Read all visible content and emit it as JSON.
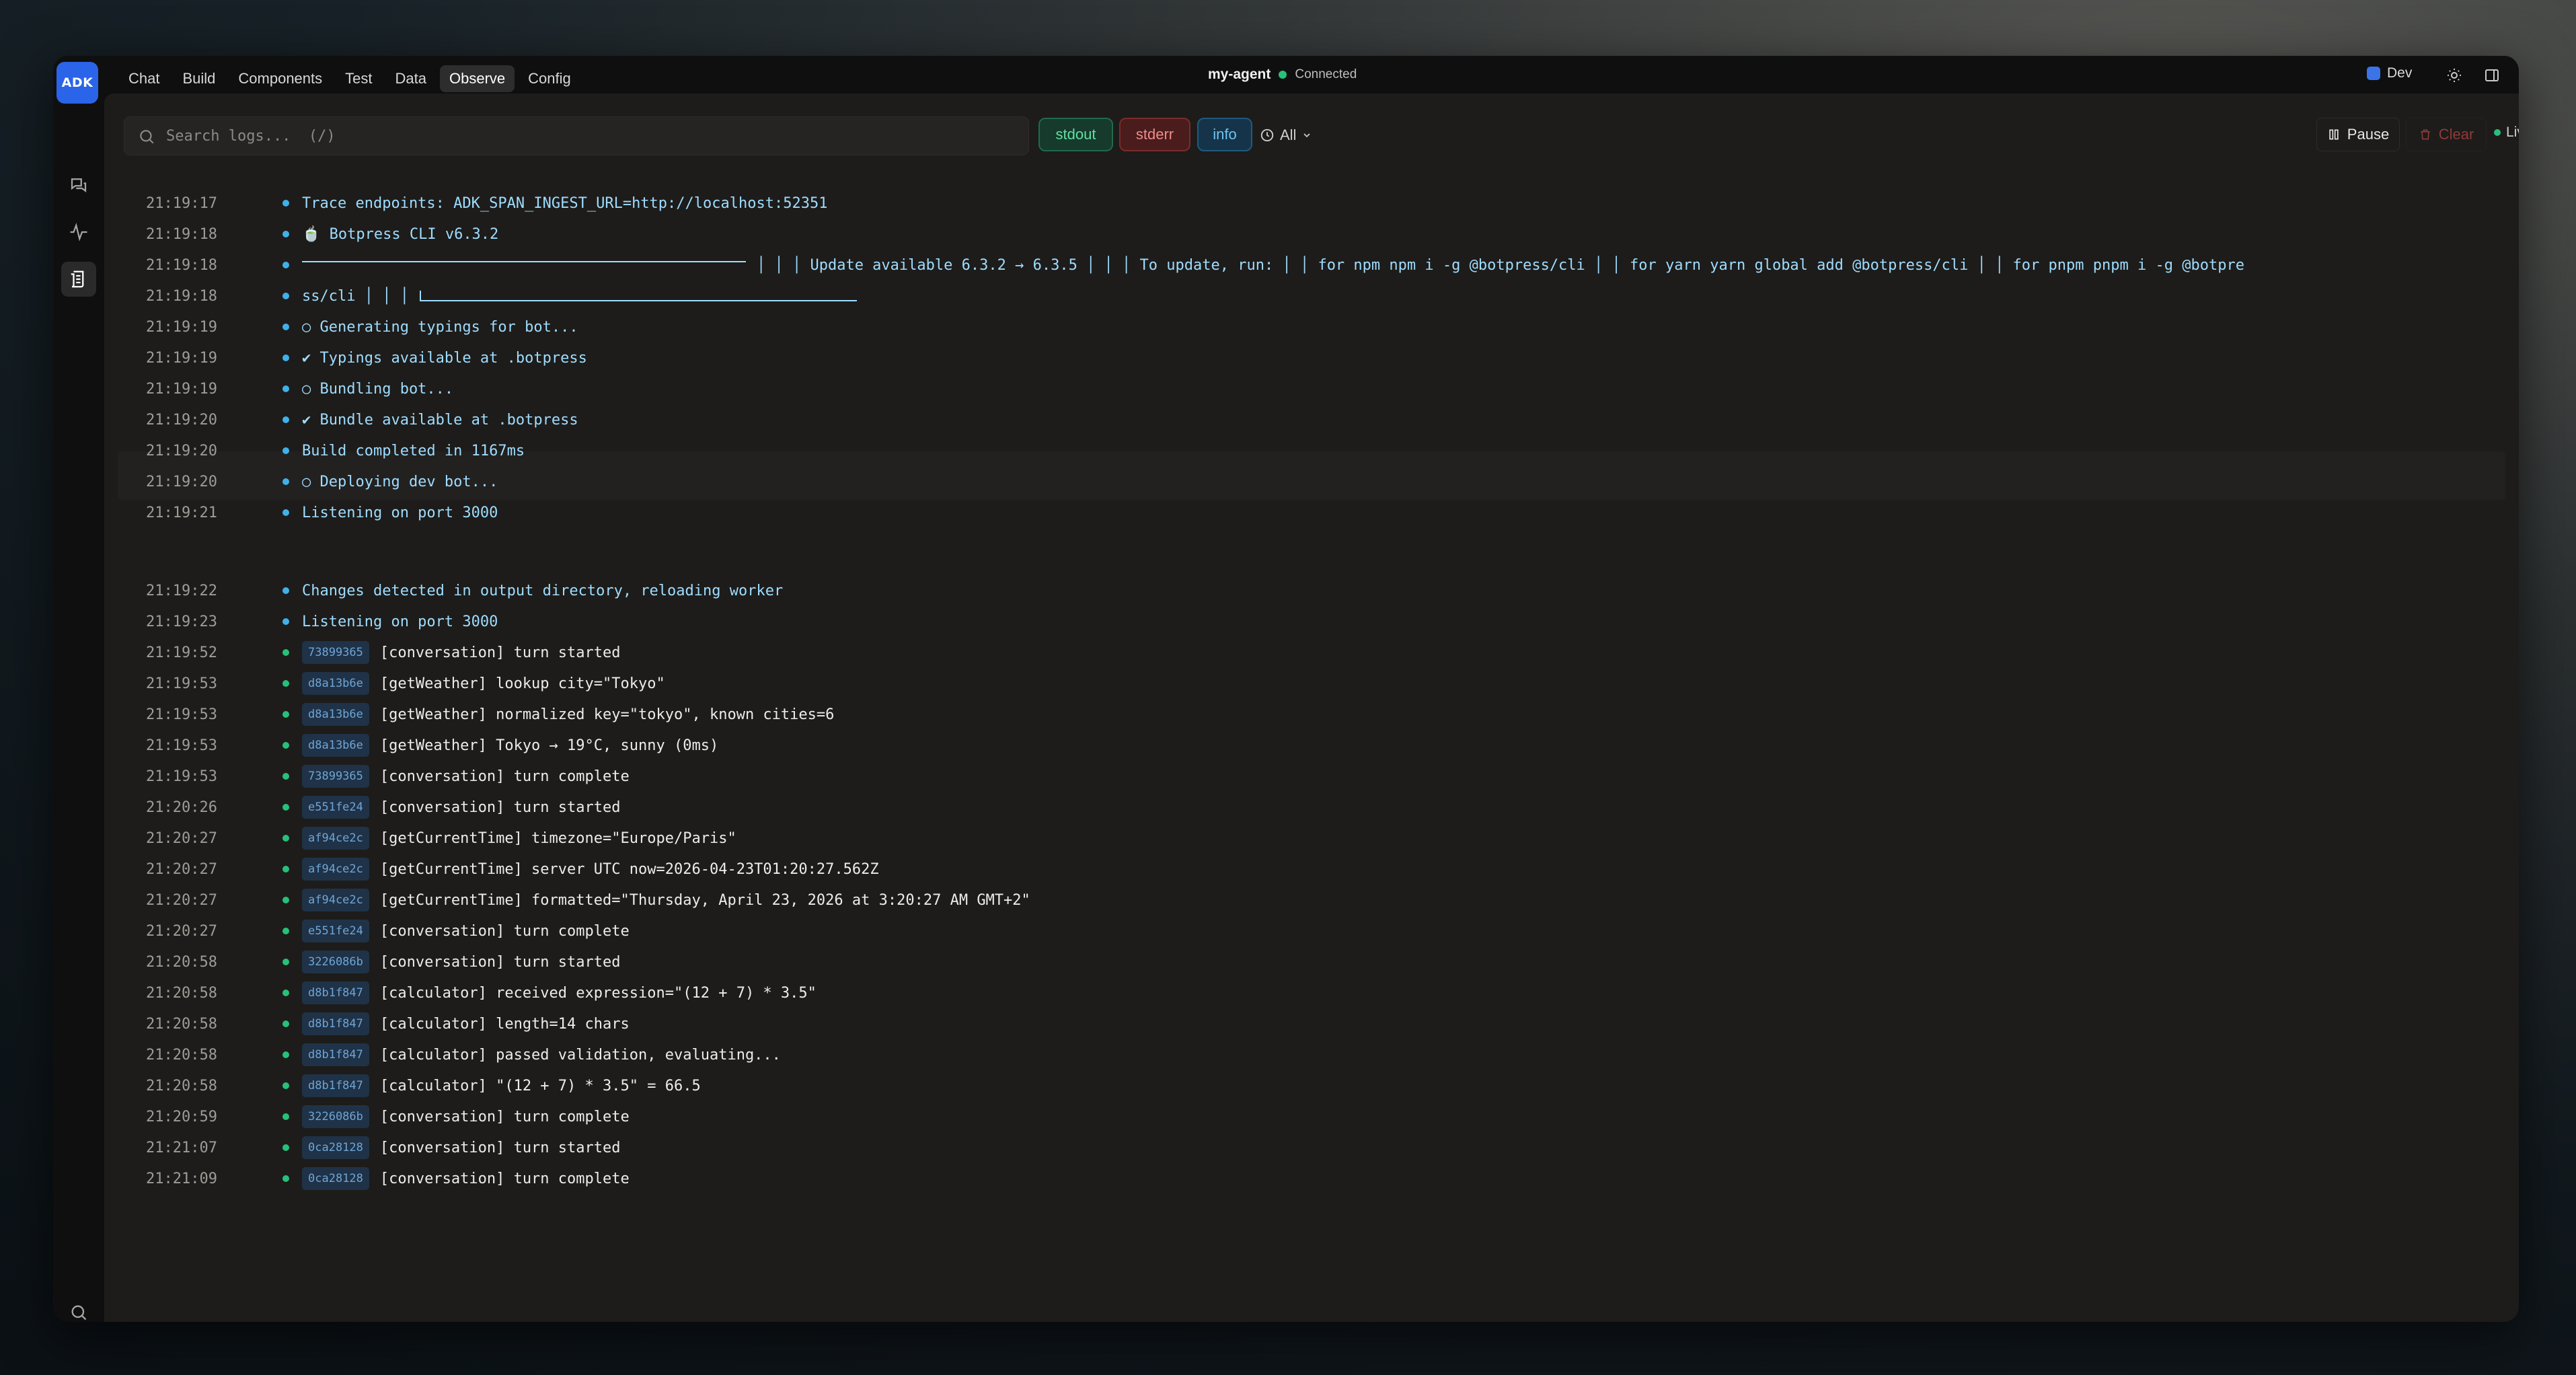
{
  "app": {
    "logo_text": "ADK",
    "agent_name": "my-agent",
    "connection_status": "Connected",
    "environment": "Dev"
  },
  "nav": {
    "items": [
      {
        "label": "Chat"
      },
      {
        "label": "Build"
      },
      {
        "label": "Components"
      },
      {
        "label": "Test"
      },
      {
        "label": "Data"
      },
      {
        "label": "Observe",
        "active": true
      },
      {
        "label": "Config"
      }
    ]
  },
  "toolbar": {
    "search_placeholder": "Search logs...  (/)",
    "filters": {
      "stdout": "stdout",
      "stderr": "stderr",
      "info": "info"
    },
    "level": "All",
    "pause_label": "Pause",
    "clear_label": "Clear",
    "live_label": "Live"
  },
  "logs": [
    {
      "time": "21:19:17",
      "kind": "info",
      "msg": "Trace endpoints: ADK_SPAN_INGEST_URL=http://localhost:52351"
    },
    {
      "time": "21:19:18",
      "kind": "info",
      "msg": "🍵 Botpress CLI v6.3.2"
    },
    {
      "time": "21:19:18",
      "kind": "info",
      "msg": "│ │ │ Update available 6.3.2 → 6.3.5 │ │ │ To update, run: │ │ for npm npm i -g @botpress/cli │ │ for yarn yarn global add @botpress/cli │ │ for pnpm pnpm i -g @botpre",
      "box": "top"
    },
    {
      "time": "21:19:18",
      "kind": "info",
      "msg": "ss/cli │ │ │",
      "box": "bottom"
    },
    {
      "time": "21:19:19",
      "kind": "info",
      "msg": "○ Generating typings for bot..."
    },
    {
      "time": "21:19:19",
      "kind": "info",
      "msg": "✔ Typings available at .botpress"
    },
    {
      "time": "21:19:19",
      "kind": "info",
      "msg": "○ Bundling bot..."
    },
    {
      "time": "21:19:20",
      "kind": "info",
      "msg": "✔ Bundle available at .botpress"
    },
    {
      "time": "21:19:20",
      "kind": "info",
      "msg": "Build completed in 1167ms"
    },
    {
      "time": "21:19:20",
      "kind": "info",
      "msg": "○ Deploying dev bot..."
    },
    {
      "time": "21:19:21",
      "kind": "info",
      "msg": "Listening on port 3000"
    },
    {
      "time": "21:19:22",
      "kind": "info",
      "msg": "Changes detected in output directory, reloading worker"
    },
    {
      "time": "21:19:23",
      "kind": "info",
      "msg": "Listening on port 3000"
    },
    {
      "time": "21:19:52",
      "kind": "out",
      "id": "73899365",
      "msg": "[conversation] turn started"
    },
    {
      "time": "21:19:53",
      "kind": "out",
      "id": "d8a13b6e",
      "msg": "[getWeather] lookup city=\"Tokyo\""
    },
    {
      "time": "21:19:53",
      "kind": "out",
      "id": "d8a13b6e",
      "msg": "[getWeather] normalized key=\"tokyo\", known cities=6"
    },
    {
      "time": "21:19:53",
      "kind": "out",
      "id": "d8a13b6e",
      "msg": "[getWeather] Tokyo → 19°C, sunny (0ms)"
    },
    {
      "time": "21:19:53",
      "kind": "out",
      "id": "73899365",
      "msg": "[conversation] turn complete"
    },
    {
      "time": "21:20:26",
      "kind": "out",
      "id": "e551fe24",
      "msg": "[conversation] turn started"
    },
    {
      "time": "21:20:27",
      "kind": "out",
      "id": "af94ce2c",
      "msg": "[getCurrentTime] timezone=\"Europe/Paris\""
    },
    {
      "time": "21:20:27",
      "kind": "out",
      "id": "af94ce2c",
      "msg": "[getCurrentTime] server UTC now=2026-04-23T01:20:27.562Z"
    },
    {
      "time": "21:20:27",
      "kind": "out",
      "id": "af94ce2c",
      "msg": "[getCurrentTime] formatted=\"Thursday, April 23, 2026 at 3:20:27 AM GMT+2\""
    },
    {
      "time": "21:20:27",
      "kind": "out",
      "id": "e551fe24",
      "msg": "[conversation] turn complete"
    },
    {
      "time": "21:20:58",
      "kind": "out",
      "id": "3226086b",
      "msg": "[conversation] turn started"
    },
    {
      "time": "21:20:58",
      "kind": "out",
      "id": "d8b1f847",
      "msg": "[calculator] received expression=\"(12 + 7) * 3.5\""
    },
    {
      "time": "21:20:58",
      "kind": "out",
      "id": "d8b1f847",
      "msg": "[calculator] length=14 chars"
    },
    {
      "time": "21:20:58",
      "kind": "out",
      "id": "d8b1f847",
      "msg": "[calculator] passed validation, evaluating..."
    },
    {
      "time": "21:20:58",
      "kind": "out",
      "id": "d8b1f847",
      "msg": "[calculator] \"(12 + 7) * 3.5\" = 66.5"
    },
    {
      "time": "21:20:59",
      "kind": "out",
      "id": "3226086b",
      "msg": "[conversation] turn complete"
    },
    {
      "time": "21:21:07",
      "kind": "out",
      "id": "0ca28128",
      "msg": "[conversation] turn started"
    },
    {
      "time": "21:21:09",
      "kind": "out",
      "id": "0ca28128",
      "msg": "[conversation] turn complete"
    }
  ],
  "icons": {
    "rail": [
      "chat-bubbles-icon",
      "activity-icon",
      "logs-icon",
      "search-icon"
    ],
    "topbar": [
      "sun-icon",
      "sidebar-toggle-icon"
    ]
  },
  "colors": {
    "accent": "#2a64e8",
    "stdout": "#5fe0a3",
    "stderr": "#f08a8a",
    "info": "#6fc3f2",
    "connected": "#27c07a"
  }
}
